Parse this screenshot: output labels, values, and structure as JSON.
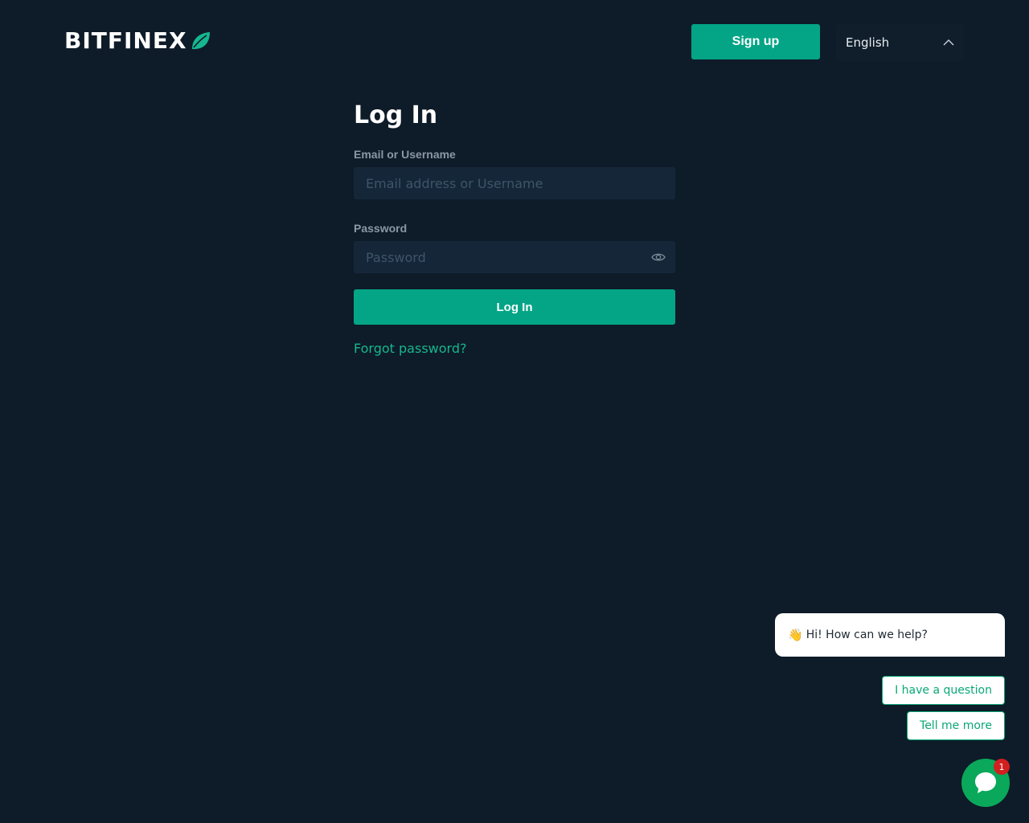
{
  "header": {
    "logo_text": "BITFINEX",
    "signup_label": "Sign up",
    "language": "English"
  },
  "login_form": {
    "title": "Log In",
    "email_label": "Email or Username",
    "email_placeholder": "Email address or Username",
    "email_value": "",
    "password_label": "Password",
    "password_placeholder": "Password",
    "password_value": "",
    "submit_label": "Log In",
    "forgot_label": "Forgot password?"
  },
  "chat_widget": {
    "greeting_emoji": "👋",
    "greeting": "Hi! How can we help?",
    "options": [
      "I have a question",
      "Tell me more"
    ],
    "unread_count": "1"
  },
  "colors": {
    "background": "#0e1b28",
    "accent": "#03a586",
    "link": "#16b78e",
    "input_bg": "#142638",
    "badge": "#d11f1f"
  },
  "icons": {
    "logo": "leaf-icon",
    "language_toggle": "chevron-up-icon",
    "password_toggle": "eye-icon",
    "chat": "chat-bubble-icon"
  }
}
